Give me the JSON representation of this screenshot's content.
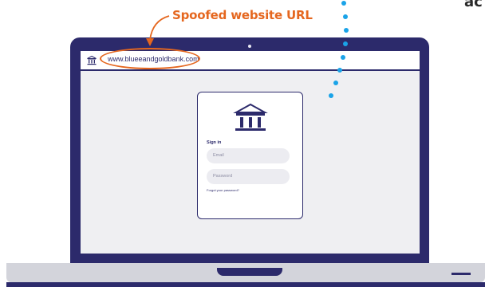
{
  "annotation": {
    "label": "Spoofed website URL",
    "corner_text": "ac"
  },
  "browser": {
    "url": "www.blueeandgoldbank.com"
  },
  "login": {
    "heading": "Sign in",
    "email_placeholder": "Email",
    "password_placeholder": "Password",
    "forgot_link": "Forgot your password?"
  },
  "icons": {
    "bank_small": "bank-icon",
    "bank_logo": "bank-icon"
  },
  "colors": {
    "accent_orange": "#e5671f",
    "laptop_navy": "#2c2a6b",
    "dots_blue": "#1aa3e8"
  }
}
